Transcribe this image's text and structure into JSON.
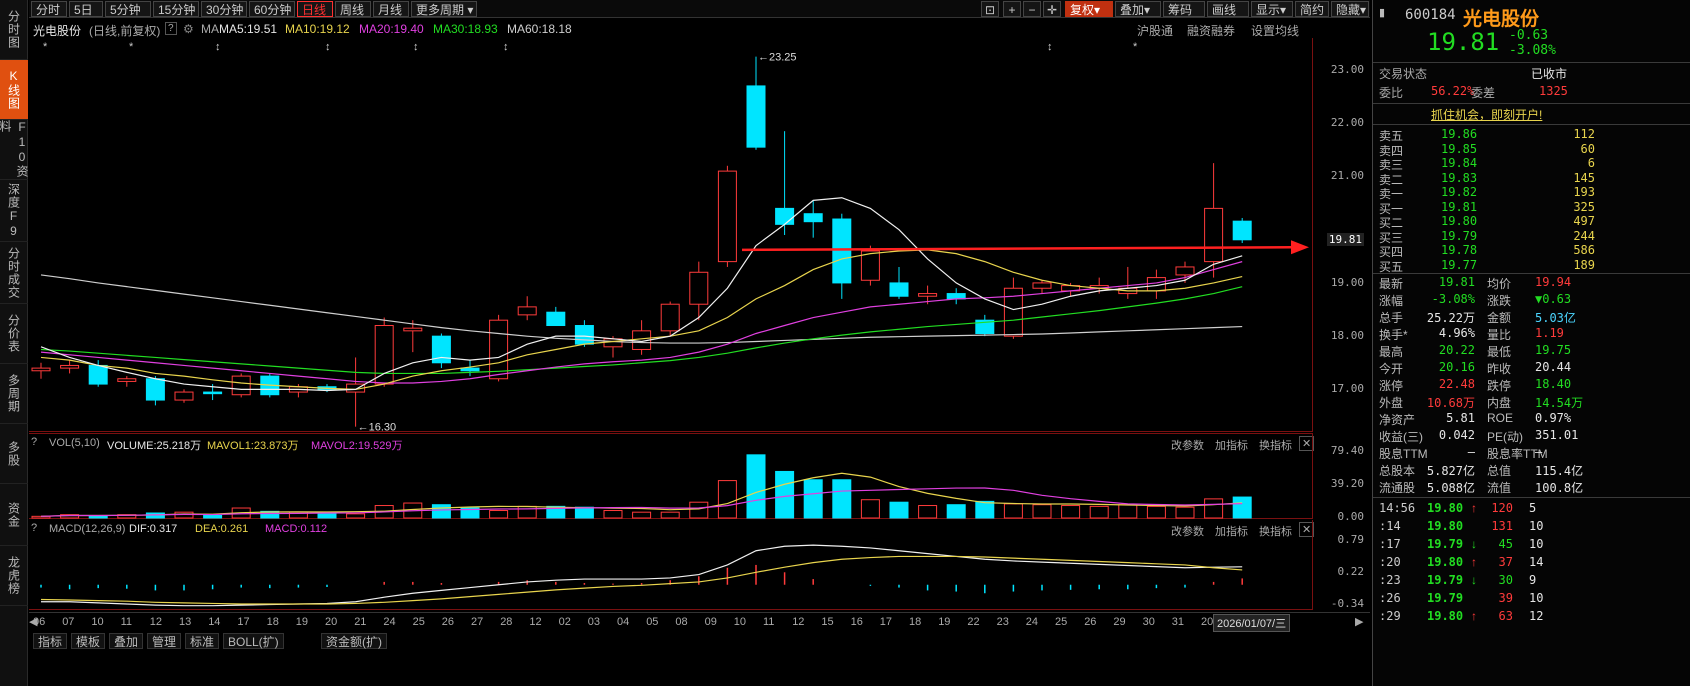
{
  "leftnav": [
    "分时图",
    "K线图",
    "F10资料",
    "深度F9",
    "分时成交",
    "分价表",
    "多周期",
    "多股",
    "资金",
    "龙虎榜"
  ],
  "toolbar": {
    "periods": [
      "分时",
      "5日",
      "5分钟",
      "15分钟",
      "30分钟",
      "60分钟",
      "日线",
      "周线",
      "月线",
      "更多周期"
    ],
    "selected_period": "日线",
    "right_buttons": [
      "复权",
      "叠加",
      "筹码",
      "画线",
      "显示",
      "简约",
      "隐藏"
    ]
  },
  "maline": {
    "stock": "光电股份",
    "mode": "(日线,前复权)",
    "ma_label": "MA",
    "ma5": "MA5:19.51",
    "ma10": "MA10:19.12",
    "ma20": "MA20:19.40",
    "ma30": "MA30:18.93",
    "ma60": "MA60:18.18",
    "links": [
      "沪股通",
      "融资融券",
      "设置均线"
    ]
  },
  "kline": {
    "yticks": [
      "23.00",
      "22.00",
      "21.00",
      "19.81",
      "19.00",
      "18.00",
      "17.00"
    ],
    "high_label": "23.25",
    "low_label": "16.30",
    "current_price": 19.81
  },
  "volume": {
    "label": "VOL(5,10)",
    "volume": "VOLUME:25.218万",
    "mavol1": "MAVOL1:23.873万",
    "mavol2": "MAVOL2:19.529万",
    "yticks": [
      "79.40",
      "39.20",
      "0.00"
    ],
    "buttons": [
      "改参数",
      "加指标",
      "换指标"
    ]
  },
  "macd": {
    "label": "MACD(12,26,9)",
    "dif": "DIF:0.317",
    "dea": "DEA:0.261",
    "macd": "MACD:0.112",
    "yticks": [
      "0.79",
      "0.22",
      "-0.34"
    ],
    "buttons": [
      "改参数",
      "加指标",
      "换指标"
    ]
  },
  "xaxis": [
    "06",
    "07",
    "10",
    "11",
    "12",
    "13",
    "14",
    "17",
    "18",
    "19",
    "20",
    "21",
    "24",
    "25",
    "26",
    "27",
    "28",
    "12",
    "02",
    "03",
    "04",
    "05",
    "08",
    "09",
    "10",
    "11",
    "12",
    "15",
    "16",
    "17",
    "18",
    "19",
    "22",
    "23",
    "24",
    "25",
    "26",
    "29",
    "30",
    "31",
    "2026"
  ],
  "date_badge": "2026/01/07/三",
  "tabs": [
    "指标",
    "模板",
    "叠加",
    "管理",
    "标准",
    "BOLL(扩)",
    "资金额(扩)"
  ],
  "quote": {
    "code": "600184",
    "name": "光电股份",
    "price": "19.81",
    "change": "-0.63",
    "pct": "-3.08%",
    "status_label": "交易状态",
    "status_value": "已收市",
    "weibi_label": "委比",
    "weibi": "56.22%",
    "weicha_label": "委差",
    "weicha": "1325",
    "banner": "抓住机会，即刻开户!",
    "sells": [
      {
        "label": "卖五",
        "price": "19.86",
        "vol": "112"
      },
      {
        "label": "卖四",
        "price": "19.85",
        "vol": "60"
      },
      {
        "label": "卖三",
        "price": "19.84",
        "vol": "6"
      },
      {
        "label": "卖二",
        "price": "19.83",
        "vol": "145"
      },
      {
        "label": "卖一",
        "price": "19.82",
        "vol": "193"
      }
    ],
    "buys": [
      {
        "label": "买一",
        "price": "19.81",
        "vol": "325"
      },
      {
        "label": "买二",
        "price": "19.80",
        "vol": "497"
      },
      {
        "label": "买三",
        "price": "19.79",
        "vol": "244"
      },
      {
        "label": "买四",
        "price": "19.78",
        "vol": "586"
      },
      {
        "label": "买五",
        "price": "19.77",
        "vol": "189"
      }
    ],
    "stats": [
      {
        "l1": "最新",
        "v1": "19.81",
        "c1": "green",
        "l2": "均价",
        "v2": "19.94",
        "c2": "red"
      },
      {
        "l1": "涨幅",
        "v1": "-3.08%",
        "c1": "green",
        "l2": "涨跌",
        "v2": "▼0.63",
        "c2": "green"
      },
      {
        "l1": "总手",
        "v1": "25.22万",
        "c1": "white",
        "l2": "金额",
        "v2": "5.03亿",
        "c2": "cyan"
      },
      {
        "l1": "换手*",
        "v1": "4.96%",
        "c1": "white",
        "l2": "量比",
        "v2": "1.19",
        "c2": "red"
      },
      {
        "l1": "最高",
        "v1": "20.22",
        "c1": "green",
        "l2": "最低",
        "v2": "19.75",
        "c2": "green"
      },
      {
        "l1": "今开",
        "v1": "20.16",
        "c1": "green",
        "l2": "昨收",
        "v2": "20.44",
        "c2": "white"
      },
      {
        "l1": "涨停",
        "v1": "22.48",
        "c1": "red",
        "l2": "跌停",
        "v2": "18.40",
        "c2": "green"
      },
      {
        "l1": "外盘",
        "v1": "10.68万",
        "c1": "red",
        "l2": "内盘",
        "v2": "14.54万",
        "c2": "green"
      },
      {
        "l1": "净资产",
        "v1": "5.81",
        "c1": "white",
        "l2": "ROE",
        "v2": "0.97%",
        "c2": "white"
      },
      {
        "l1": "收益(三)",
        "v1": "0.042",
        "c1": "white",
        "l2": "PE(动)",
        "v2": "351.01",
        "c2": "white"
      },
      {
        "l1": "股息TTM",
        "v1": "—",
        "c1": "white",
        "l2": "股息率TTM",
        "v2": "—",
        "c2": "white"
      },
      {
        "l1": "总股本",
        "v1": "5.827亿",
        "c1": "white",
        "l2": "总值",
        "v2": "115.4亿",
        "c2": "white"
      },
      {
        "l1": "流通股",
        "v1": "5.088亿",
        "c1": "white",
        "l2": "流值",
        "v2": "100.8亿",
        "c2": "white"
      }
    ],
    "ticks": [
      {
        "time": "14:56",
        "price": "19.80",
        "arrow": "↑",
        "vol": "120",
        "n": "5"
      },
      {
        "time": ":14",
        "price": "19.80",
        "arrow": "",
        "vol": "131",
        "n": "10"
      },
      {
        "time": ":17",
        "price": "19.79",
        "arrow": "↓",
        "vol": "45",
        "n": "10"
      },
      {
        "time": ":20",
        "price": "19.80",
        "arrow": "↑",
        "vol": "37",
        "n": "14"
      },
      {
        "time": ":23",
        "price": "19.79",
        "arrow": "↓",
        "vol": "30",
        "n": "9"
      },
      {
        "time": ":26",
        "price": "19.79",
        "arrow": "",
        "vol": "39",
        "n": "10"
      },
      {
        "time": ":29",
        "price": "19.80",
        "arrow": "↑",
        "vol": "63",
        "n": "12"
      }
    ]
  },
  "chart_data": {
    "type": "candlestick",
    "ohlc": [
      [
        17.35,
        17.5,
        17.2,
        17.4
      ],
      [
        17.4,
        17.55,
        17.3,
        17.45
      ],
      [
        17.45,
        17.55,
        17.05,
        17.1
      ],
      [
        17.15,
        17.25,
        17.05,
        17.2
      ],
      [
        17.2,
        17.25,
        16.7,
        16.8
      ],
      [
        16.8,
        17.0,
        16.75,
        16.95
      ],
      [
        16.95,
        17.1,
        16.8,
        16.92
      ],
      [
        16.9,
        17.3,
        16.85,
        17.25
      ],
      [
        17.25,
        17.3,
        16.85,
        16.9
      ],
      [
        16.95,
        17.1,
        16.85,
        17.05
      ],
      [
        17.05,
        17.1,
        16.95,
        17.0
      ],
      [
        16.95,
        17.6,
        16.3,
        17.1
      ],
      [
        17.1,
        18.35,
        17.05,
        18.2
      ],
      [
        18.1,
        18.3,
        17.7,
        18.15
      ],
      [
        18.0,
        18.05,
        17.4,
        17.5
      ],
      [
        17.4,
        17.55,
        17.25,
        17.35
      ],
      [
        17.2,
        18.4,
        17.15,
        18.3
      ],
      [
        18.4,
        18.75,
        18.3,
        18.55
      ],
      [
        18.45,
        18.55,
        18.2,
        18.2
      ],
      [
        18.2,
        18.3,
        17.8,
        17.85
      ],
      [
        17.8,
        18.0,
        17.6,
        17.95
      ],
      [
        17.75,
        18.3,
        17.65,
        18.1
      ],
      [
        18.1,
        18.65,
        18.0,
        18.6
      ],
      [
        18.6,
        19.4,
        18.3,
        19.2
      ],
      [
        19.4,
        21.2,
        19.3,
        21.1
      ],
      [
        22.7,
        23.25,
        21.5,
        21.55
      ],
      [
        20.4,
        21.85,
        19.9,
        20.1
      ],
      [
        20.3,
        20.55,
        19.85,
        20.15
      ],
      [
        20.2,
        20.3,
        18.7,
        19.0
      ],
      [
        19.05,
        19.7,
        18.95,
        19.6
      ],
      [
        19.0,
        19.3,
        18.7,
        18.75
      ],
      [
        18.75,
        18.95,
        18.6,
        18.8
      ],
      [
        18.8,
        18.9,
        18.6,
        18.7
      ],
      [
        18.3,
        18.4,
        18.0,
        18.05
      ],
      [
        18.0,
        19.1,
        17.95,
        18.9
      ],
      [
        18.9,
        19.05,
        18.8,
        19.0
      ],
      [
        18.85,
        19.0,
        18.75,
        18.95
      ],
      [
        18.9,
        19.1,
        18.8,
        18.95
      ],
      [
        18.8,
        19.3,
        18.7,
        18.9
      ],
      [
        18.85,
        19.25,
        18.7,
        19.1
      ],
      [
        19.15,
        19.4,
        19.0,
        19.3
      ],
      [
        19.4,
        21.25,
        19.1,
        20.4
      ],
      [
        20.16,
        20.22,
        19.75,
        19.81
      ]
    ],
    "ma5": [
      17.8,
      17.6,
      17.45,
      17.32,
      17.2,
      17.1,
      17.05,
      17.0,
      17.0,
      17.0,
      16.98,
      17.0,
      17.3,
      17.5,
      17.6,
      17.55,
      17.6,
      17.85,
      18.0,
      18.0,
      17.95,
      17.9,
      18.0,
      18.35,
      18.9,
      19.7,
      20.1,
      20.55,
      20.6,
      20.4,
      20.0,
      19.45,
      19.0,
      18.7,
      18.5,
      18.6,
      18.75,
      18.85,
      18.9,
      18.95,
      19.05,
      19.35,
      19.51
    ],
    "ma10": [
      17.6,
      17.55,
      17.45,
      17.4,
      17.3,
      17.25,
      17.18,
      17.12,
      17.08,
      17.05,
      17.02,
      17.0,
      17.1,
      17.25,
      17.35,
      17.42,
      17.5,
      17.65,
      17.75,
      17.85,
      17.9,
      17.95,
      18.0,
      18.1,
      18.35,
      18.7,
      18.95,
      19.25,
      19.45,
      19.55,
      19.6,
      19.62,
      19.55,
      19.4,
      19.2,
      19.05,
      18.95,
      18.9,
      18.85,
      18.85,
      18.9,
      19.0,
      19.12
    ],
    "ma20": [
      17.7,
      17.65,
      17.6,
      17.55,
      17.5,
      17.45,
      17.4,
      17.35,
      17.3,
      17.25,
      17.2,
      17.15,
      17.12,
      17.12,
      17.15,
      17.2,
      17.28,
      17.35,
      17.42,
      17.48,
      17.52,
      17.55,
      17.6,
      17.7,
      17.85,
      18.05,
      18.2,
      18.35,
      18.45,
      18.55,
      18.6,
      18.65,
      18.7,
      18.72,
      18.75,
      18.8,
      18.85,
      18.9,
      18.95,
      19.0,
      19.1,
      19.25,
      19.4
    ],
    "ma30": [
      17.75,
      17.72,
      17.68,
      17.64,
      17.6,
      17.56,
      17.52,
      17.48,
      17.44,
      17.4,
      17.36,
      17.32,
      17.3,
      17.3,
      17.3,
      17.32,
      17.34,
      17.37,
      17.4,
      17.43,
      17.46,
      17.5,
      17.54,
      17.6,
      17.68,
      17.78,
      17.87,
      17.95,
      18.02,
      18.08,
      18.13,
      18.18,
      18.22,
      18.26,
      18.3,
      18.36,
      18.42,
      18.48,
      18.55,
      18.62,
      18.7,
      18.8,
      18.93
    ],
    "ma60": [
      19.15,
      19.08,
      19.0,
      18.93,
      18.86,
      18.79,
      18.72,
      18.65,
      18.58,
      18.51,
      18.44,
      18.37,
      18.3,
      18.23,
      18.16,
      18.1,
      18.05,
      18.0,
      17.96,
      17.93,
      17.9,
      17.88,
      17.87,
      17.87,
      17.88,
      17.9,
      17.92,
      17.94,
      17.96,
      17.98,
      17.99,
      18.0,
      18.01,
      18.02,
      18.03,
      18.04,
      18.06,
      18.08,
      18.1,
      18.12,
      18.14,
      18.16,
      18.18
    ],
    "volumes": [
      2,
      4,
      3,
      4,
      6,
      7,
      3,
      12,
      8,
      7,
      6,
      5,
      15,
      18,
      16,
      12,
      9,
      14,
      14,
      13,
      9,
      7,
      7,
      19,
      45,
      76,
      56,
      46,
      46,
      22,
      19,
      15,
      16,
      20,
      17,
      16,
      15,
      14,
      16,
      14,
      13,
      23,
      25.2
    ],
    "vol_ylim": [
      0,
      79.4
    ],
    "macd_hist": [
      -0.05,
      -0.08,
      -0.06,
      -0.07,
      -0.1,
      -0.1,
      -0.08,
      -0.05,
      -0.06,
      -0.05,
      -0.04,
      0.0,
      0.05,
      0.05,
      0.03,
      0.0,
      0.05,
      0.08,
      0.05,
      0.03,
      0.02,
      0.03,
      0.08,
      0.15,
      0.3,
      0.35,
      0.22,
      0.1,
      0.0,
      -0.02,
      -0.05,
      -0.1,
      -0.12,
      -0.15,
      -0.12,
      -0.1,
      -0.09,
      -0.08,
      -0.08,
      -0.06,
      -0.05,
      0.05,
      0.112
    ],
    "dif": [
      -0.3,
      -0.3,
      -0.32,
      -0.34,
      -0.36,
      -0.37,
      -0.37,
      -0.36,
      -0.35,
      -0.34,
      -0.33,
      -0.3,
      -0.22,
      -0.15,
      -0.1,
      -0.05,
      0.0,
      0.05,
      0.08,
      0.1,
      0.1,
      0.1,
      0.12,
      0.18,
      0.35,
      0.6,
      0.68,
      0.7,
      0.68,
      0.65,
      0.6,
      0.55,
      0.5,
      0.45,
      0.42,
      0.4,
      0.38,
      0.36,
      0.34,
      0.32,
      0.3,
      0.31,
      0.317
    ],
    "dea": [
      -0.26,
      -0.27,
      -0.28,
      -0.29,
      -0.31,
      -0.32,
      -0.33,
      -0.34,
      -0.34,
      -0.34,
      -0.34,
      -0.33,
      -0.31,
      -0.28,
      -0.25,
      -0.21,
      -0.17,
      -0.13,
      -0.09,
      -0.06,
      -0.03,
      -0.01,
      0.02,
      0.05,
      0.12,
      0.22,
      0.31,
      0.39,
      0.45,
      0.48,
      0.5,
      0.5,
      0.5,
      0.49,
      0.47,
      0.45,
      0.43,
      0.41,
      0.39,
      0.37,
      0.35,
      0.3,
      0.261
    ],
    "macd_ylim": [
      -0.34,
      0.79
    ],
    "price_ylim": [
      16.2,
      23.6
    ]
  }
}
